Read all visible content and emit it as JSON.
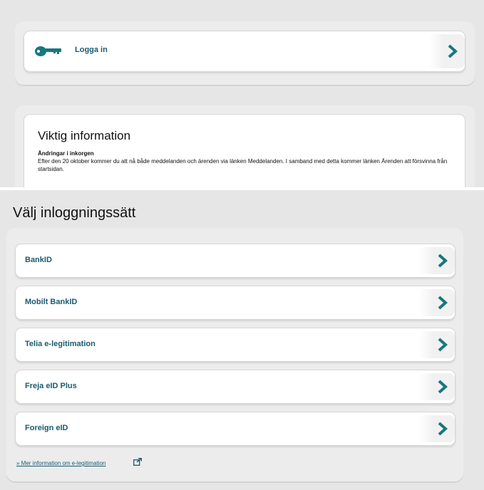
{
  "login": {
    "label": "Logga in"
  },
  "info": {
    "title": "Viktig information",
    "subtitle": "Ändringar i inkorgen",
    "body": "Efter den 20 oktober kommer du att nå både meddelanden och ärenden via länken Meddelanden. I samband med detta kommer länken Ärenden att försvinna från startsidan."
  },
  "methods": {
    "title": "Välj inloggningssätt",
    "items": [
      {
        "label": "BankID"
      },
      {
        "label": "Mobilt BankID"
      },
      {
        "label": "Telia e-legitimation"
      },
      {
        "label": "Freja eID Plus"
      },
      {
        "label": "Foreign eID"
      }
    ],
    "more_link": "» Mer information om e-legitimation"
  },
  "colors": {
    "accent": "#1b5a6e",
    "icon": "#16787f",
    "panel": "#e6e6e6"
  },
  "icons": {
    "key": "key-icon",
    "chevron": "chevron-right-icon",
    "external": "external-link-icon"
  }
}
